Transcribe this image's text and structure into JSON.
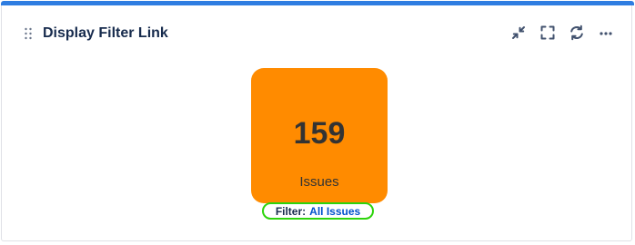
{
  "gadget": {
    "title": "Display Filter Link",
    "accent_color": "#2e7de1",
    "actions": [
      "minimize-icon",
      "fullscreen-icon",
      "refresh-icon",
      "more-icon"
    ]
  },
  "tile": {
    "count": "159",
    "label": "Issues",
    "color": "#ff8b00"
  },
  "filter": {
    "prefix": "Filter:",
    "link_text": "All Issues",
    "highlight_color": "#2cd40b"
  }
}
